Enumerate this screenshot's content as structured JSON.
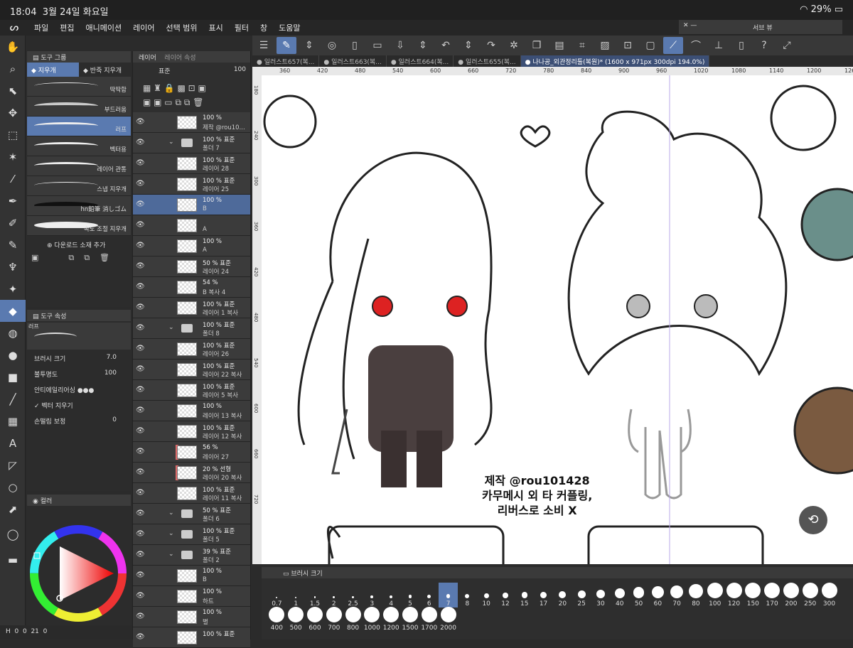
{
  "status": {
    "time": "18:04",
    "date": "3월 24일 화요일",
    "battery": "29%"
  },
  "menu": [
    "파일",
    "편집",
    "애니메이션",
    "레이어",
    "선택 범위",
    "표시",
    "필터",
    "창",
    "도움말"
  ],
  "subview": {
    "title": "서브 뷰"
  },
  "tool_group": {
    "title": "도구 그룹",
    "tabs": [
      "지우개",
      "반죽 지우개"
    ],
    "brushes": [
      "딱딱함",
      "부드러움",
      "러프",
      "벡터용",
      "레이어 관통",
      "스냅 지우개",
      "hn鉛筆 消しゴム",
      "속도 조절 지우개"
    ],
    "selected_brush": "러프",
    "add_material": "다운로드 소재 추가"
  },
  "tool_props": {
    "title": "도구 속성",
    "brush_name": "러프",
    "brush_size_label": "브러시 크기",
    "brush_size": "7.0",
    "opacity_label": "불투명도",
    "opacity": "100",
    "antialias_label": "안티에일리어싱",
    "vector_label": "벡터 지우기",
    "stabilizer_label": "손떨림 보정",
    "stabilizer": "0"
  },
  "color": {
    "title": "컬러"
  },
  "bottom_status": {
    "h": "H",
    "h_val": "0",
    "s": "0",
    "l": "21",
    "b": "0"
  },
  "layer_panel": {
    "tabs": [
      "레이어",
      "레이어 속성"
    ],
    "blend": "표준",
    "opacity": "100",
    "layers": [
      {
        "op": "100 %",
        "name": "제작 @rou10...",
        "kind": "text"
      },
      {
        "op": "100 % 표준",
        "name": "폴더 7",
        "kind": "folder"
      },
      {
        "op": "100 % 표준",
        "name": "레이어 28",
        "kind": "layer"
      },
      {
        "op": "100 % 표준",
        "name": "레이어 25",
        "kind": "layer"
      },
      {
        "op": "100 %",
        "name": "B",
        "kind": "layer",
        "sel": true
      },
      {
        "op": "",
        "name": "A",
        "kind": "layer"
      },
      {
        "op": "100 %",
        "name": "A",
        "kind": "layer"
      },
      {
        "op": "50 % 표준",
        "name": "레이어 24",
        "kind": "layer"
      },
      {
        "op": "54 %",
        "name": "B 복사 4",
        "kind": "layer"
      },
      {
        "op": "100 % 표준",
        "name": "레이어 1 복사",
        "kind": "layer"
      },
      {
        "op": "100 % 표준",
        "name": "폴더 8",
        "kind": "folder"
      },
      {
        "op": "100 % 표준",
        "name": "레이어 26",
        "kind": "layer"
      },
      {
        "op": "100 % 표준",
        "name": "레이어 22 복사",
        "kind": "layer"
      },
      {
        "op": "100 % 표준",
        "name": "레이어 5 복사",
        "kind": "layer"
      },
      {
        "op": "100 %",
        "name": "레이어 13 복사",
        "kind": "layer"
      },
      {
        "op": "100 % 표준",
        "name": "레이어 12 복사",
        "kind": "layer"
      },
      {
        "op": "56 %",
        "name": "레이어 27",
        "kind": "layer",
        "mark": true
      },
      {
        "op": "20 % 선형",
        "name": "레이어 20 복사",
        "kind": "layer",
        "mark": true
      },
      {
        "op": "100 % 표준",
        "name": "레이어 11 복사",
        "kind": "layer"
      },
      {
        "op": "50 % 표준",
        "name": "폴더 6",
        "kind": "folder"
      },
      {
        "op": "100 % 표준",
        "name": "폴더 5",
        "kind": "folder"
      },
      {
        "op": "39 % 표준",
        "name": "폴더 2",
        "kind": "folder"
      },
      {
        "op": "100 %",
        "name": "B",
        "kind": "layer"
      },
      {
        "op": "100 %",
        "name": "하트",
        "kind": "layer"
      },
      {
        "op": "100 %",
        "name": "별",
        "kind": "layer"
      },
      {
        "op": "100 % 표준",
        "name": "",
        "kind": "layer"
      }
    ]
  },
  "doc_tabs": [
    "일러스트657(복...",
    "일러스트663(복...",
    "일러스트664(복...",
    "일러스트655(복...",
    "나나공_외관정리툴(복원)* (1600 x 971px 300dpi 194.0%)"
  ],
  "ruler_labels": [
    "360",
    "420",
    "480",
    "540",
    "600",
    "660",
    "720",
    "780",
    "840",
    "900",
    "960",
    "1020",
    "1080",
    "1140",
    "1200",
    "1260"
  ],
  "vruler_labels": [
    "180",
    "240",
    "300",
    "360",
    "420",
    "480",
    "540",
    "600",
    "660",
    "720"
  ],
  "canvas_text": {
    "line1": "제작 @rou101428",
    "line2": "카무메시 외 타 커플링,",
    "line3": "리버스로 소비 X"
  },
  "brush_size_bar": {
    "title": "브러시 크기",
    "row1": [
      "0.7",
      "1",
      "1.5",
      "2",
      "2.5",
      "3",
      "4",
      "5",
      "6",
      "7",
      "8",
      "10",
      "12",
      "15",
      "17",
      "20",
      "25",
      "30",
      "40",
      "50",
      "60",
      "70",
      "80",
      "100",
      "120",
      "150",
      "170",
      "200",
      "250",
      "300"
    ],
    "row2": [
      "400",
      "500",
      "600",
      "700",
      "800",
      "1000",
      "1200",
      "1500",
      "1700",
      "2000"
    ],
    "selected": "7"
  }
}
